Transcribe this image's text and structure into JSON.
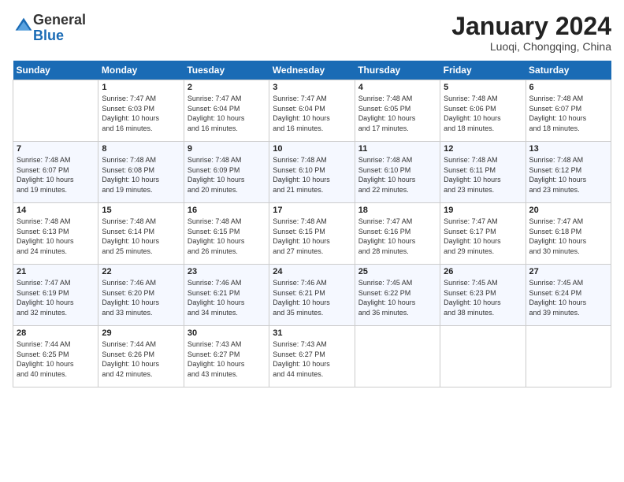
{
  "logo": {
    "general": "General",
    "blue": "Blue"
  },
  "header": {
    "title": "January 2024",
    "subtitle": "Luoqi, Chongqing, China"
  },
  "weekdays": [
    "Sunday",
    "Monday",
    "Tuesday",
    "Wednesday",
    "Thursday",
    "Friday",
    "Saturday"
  ],
  "weeks": [
    [
      {
        "day": "",
        "sunrise": "",
        "sunset": "",
        "daylight": ""
      },
      {
        "day": "1",
        "sunrise": "Sunrise: 7:47 AM",
        "sunset": "Sunset: 6:03 PM",
        "daylight": "Daylight: 10 hours and 16 minutes."
      },
      {
        "day": "2",
        "sunrise": "Sunrise: 7:47 AM",
        "sunset": "Sunset: 6:04 PM",
        "daylight": "Daylight: 10 hours and 16 minutes."
      },
      {
        "day": "3",
        "sunrise": "Sunrise: 7:47 AM",
        "sunset": "Sunset: 6:04 PM",
        "daylight": "Daylight: 10 hours and 16 minutes."
      },
      {
        "day": "4",
        "sunrise": "Sunrise: 7:48 AM",
        "sunset": "Sunset: 6:05 PM",
        "daylight": "Daylight: 10 hours and 17 minutes."
      },
      {
        "day": "5",
        "sunrise": "Sunrise: 7:48 AM",
        "sunset": "Sunset: 6:06 PM",
        "daylight": "Daylight: 10 hours and 18 minutes."
      },
      {
        "day": "6",
        "sunrise": "Sunrise: 7:48 AM",
        "sunset": "Sunset: 6:07 PM",
        "daylight": "Daylight: 10 hours and 18 minutes."
      }
    ],
    [
      {
        "day": "7",
        "sunrise": "Sunrise: 7:48 AM",
        "sunset": "Sunset: 6:07 PM",
        "daylight": "Daylight: 10 hours and 19 minutes."
      },
      {
        "day": "8",
        "sunrise": "Sunrise: 7:48 AM",
        "sunset": "Sunset: 6:08 PM",
        "daylight": "Daylight: 10 hours and 19 minutes."
      },
      {
        "day": "9",
        "sunrise": "Sunrise: 7:48 AM",
        "sunset": "Sunset: 6:09 PM",
        "daylight": "Daylight: 10 hours and 20 minutes."
      },
      {
        "day": "10",
        "sunrise": "Sunrise: 7:48 AM",
        "sunset": "Sunset: 6:10 PM",
        "daylight": "Daylight: 10 hours and 21 minutes."
      },
      {
        "day": "11",
        "sunrise": "Sunrise: 7:48 AM",
        "sunset": "Sunset: 6:10 PM",
        "daylight": "Daylight: 10 hours and 22 minutes."
      },
      {
        "day": "12",
        "sunrise": "Sunrise: 7:48 AM",
        "sunset": "Sunset: 6:11 PM",
        "daylight": "Daylight: 10 hours and 23 minutes."
      },
      {
        "day": "13",
        "sunrise": "Sunrise: 7:48 AM",
        "sunset": "Sunset: 6:12 PM",
        "daylight": "Daylight: 10 hours and 23 minutes."
      }
    ],
    [
      {
        "day": "14",
        "sunrise": "Sunrise: 7:48 AM",
        "sunset": "Sunset: 6:13 PM",
        "daylight": "Daylight: 10 hours and 24 minutes."
      },
      {
        "day": "15",
        "sunrise": "Sunrise: 7:48 AM",
        "sunset": "Sunset: 6:14 PM",
        "daylight": "Daylight: 10 hours and 25 minutes."
      },
      {
        "day": "16",
        "sunrise": "Sunrise: 7:48 AM",
        "sunset": "Sunset: 6:15 PM",
        "daylight": "Daylight: 10 hours and 26 minutes."
      },
      {
        "day": "17",
        "sunrise": "Sunrise: 7:48 AM",
        "sunset": "Sunset: 6:15 PM",
        "daylight": "Daylight: 10 hours and 27 minutes."
      },
      {
        "day": "18",
        "sunrise": "Sunrise: 7:47 AM",
        "sunset": "Sunset: 6:16 PM",
        "daylight": "Daylight: 10 hours and 28 minutes."
      },
      {
        "day": "19",
        "sunrise": "Sunrise: 7:47 AM",
        "sunset": "Sunset: 6:17 PM",
        "daylight": "Daylight: 10 hours and 29 minutes."
      },
      {
        "day": "20",
        "sunrise": "Sunrise: 7:47 AM",
        "sunset": "Sunset: 6:18 PM",
        "daylight": "Daylight: 10 hours and 30 minutes."
      }
    ],
    [
      {
        "day": "21",
        "sunrise": "Sunrise: 7:47 AM",
        "sunset": "Sunset: 6:19 PM",
        "daylight": "Daylight: 10 hours and 32 minutes."
      },
      {
        "day": "22",
        "sunrise": "Sunrise: 7:46 AM",
        "sunset": "Sunset: 6:20 PM",
        "daylight": "Daylight: 10 hours and 33 minutes."
      },
      {
        "day": "23",
        "sunrise": "Sunrise: 7:46 AM",
        "sunset": "Sunset: 6:21 PM",
        "daylight": "Daylight: 10 hours and 34 minutes."
      },
      {
        "day": "24",
        "sunrise": "Sunrise: 7:46 AM",
        "sunset": "Sunset: 6:21 PM",
        "daylight": "Daylight: 10 hours and 35 minutes."
      },
      {
        "day": "25",
        "sunrise": "Sunrise: 7:45 AM",
        "sunset": "Sunset: 6:22 PM",
        "daylight": "Daylight: 10 hours and 36 minutes."
      },
      {
        "day": "26",
        "sunrise": "Sunrise: 7:45 AM",
        "sunset": "Sunset: 6:23 PM",
        "daylight": "Daylight: 10 hours and 38 minutes."
      },
      {
        "day": "27",
        "sunrise": "Sunrise: 7:45 AM",
        "sunset": "Sunset: 6:24 PM",
        "daylight": "Daylight: 10 hours and 39 minutes."
      }
    ],
    [
      {
        "day": "28",
        "sunrise": "Sunrise: 7:44 AM",
        "sunset": "Sunset: 6:25 PM",
        "daylight": "Daylight: 10 hours and 40 minutes."
      },
      {
        "day": "29",
        "sunrise": "Sunrise: 7:44 AM",
        "sunset": "Sunset: 6:26 PM",
        "daylight": "Daylight: 10 hours and 42 minutes."
      },
      {
        "day": "30",
        "sunrise": "Sunrise: 7:43 AM",
        "sunset": "Sunset: 6:27 PM",
        "daylight": "Daylight: 10 hours and 43 minutes."
      },
      {
        "day": "31",
        "sunrise": "Sunrise: 7:43 AM",
        "sunset": "Sunset: 6:27 PM",
        "daylight": "Daylight: 10 hours and 44 minutes."
      },
      {
        "day": "",
        "sunrise": "",
        "sunset": "",
        "daylight": ""
      },
      {
        "day": "",
        "sunrise": "",
        "sunset": "",
        "daylight": ""
      },
      {
        "day": "",
        "sunrise": "",
        "sunset": "",
        "daylight": ""
      }
    ]
  ]
}
